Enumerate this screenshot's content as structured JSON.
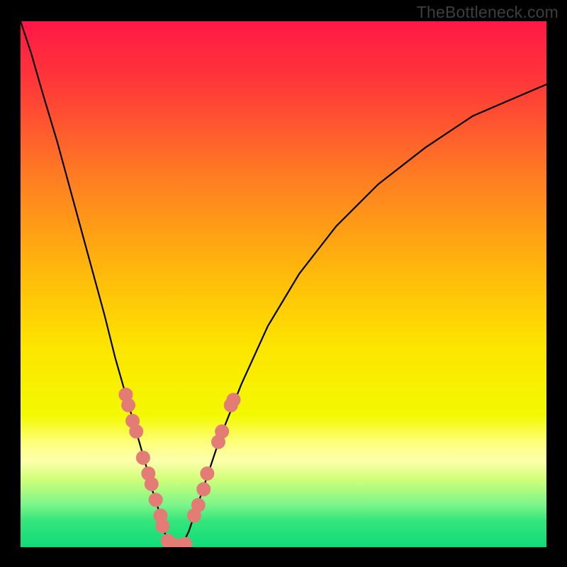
{
  "watermark": "TheBottleneck.com",
  "chart_data": {
    "type": "line",
    "title": "",
    "xlabel": "",
    "ylabel": "",
    "xlim": [
      0,
      100
    ],
    "ylim": [
      0,
      100
    ],
    "grid": false,
    "legend": "none",
    "background": {
      "type": "vertical-gradient",
      "stops": [
        {
          "pos": 0.0,
          "color": "#ff1846"
        },
        {
          "pos": 0.12,
          "color": "#ff3939"
        },
        {
          "pos": 0.3,
          "color": "#ff7e22"
        },
        {
          "pos": 0.48,
          "color": "#ffba0b"
        },
        {
          "pos": 0.62,
          "color": "#fde500"
        },
        {
          "pos": 0.75,
          "color": "#f3f901"
        },
        {
          "pos": 0.8,
          "color": "#feff7a"
        },
        {
          "pos": 0.835,
          "color": "#fdffad"
        },
        {
          "pos": 0.87,
          "color": "#d2ff7a"
        },
        {
          "pos": 0.92,
          "color": "#7af589"
        },
        {
          "pos": 0.95,
          "color": "#35e57c"
        },
        {
          "pos": 1.0,
          "color": "#0edc78"
        }
      ]
    },
    "curve": {
      "description": "V-shaped bottleneck curve, minimum near x≈28, value≈0; rises to ~100 at x=0 and ~88 at x=100.",
      "x": [
        0,
        2,
        4,
        7,
        10,
        13,
        16,
        18,
        20,
        22,
        24,
        25,
        26,
        27,
        28,
        29,
        30,
        31,
        32,
        33,
        35,
        38,
        42,
        47,
        53,
        60,
        68,
        77,
        86,
        93,
        100
      ],
      "y": [
        100,
        94,
        87,
        77,
        66,
        55,
        44,
        36,
        29,
        22,
        15,
        11,
        8,
        4,
        1,
        0,
        0,
        1,
        3,
        6,
        12,
        21,
        31,
        42,
        52,
        61,
        69,
        76,
        82,
        85,
        88
      ]
    },
    "markers": {
      "description": "Salmon-colored dot clusters on both flanks of the V and at the base.",
      "color": "#e47c76",
      "radius_px": 10,
      "points": [
        {
          "x": 20.0,
          "y": 29
        },
        {
          "x": 20.5,
          "y": 27
        },
        {
          "x": 21.3,
          "y": 24
        },
        {
          "x": 22.0,
          "y": 22
        },
        {
          "x": 23.3,
          "y": 17
        },
        {
          "x": 24.3,
          "y": 14
        },
        {
          "x": 24.9,
          "y": 12
        },
        {
          "x": 25.7,
          "y": 9
        },
        {
          "x": 26.6,
          "y": 6
        },
        {
          "x": 27.0,
          "y": 4
        },
        {
          "x": 28.0,
          "y": 1.2
        },
        {
          "x": 28.8,
          "y": 0.5
        },
        {
          "x": 29.7,
          "y": 0.3
        },
        {
          "x": 30.5,
          "y": 0.3
        },
        {
          "x": 31.3,
          "y": 0.6
        },
        {
          "x": 33.0,
          "y": 6
        },
        {
          "x": 33.8,
          "y": 8
        },
        {
          "x": 34.8,
          "y": 11
        },
        {
          "x": 35.5,
          "y": 14
        },
        {
          "x": 37.6,
          "y": 20
        },
        {
          "x": 38.3,
          "y": 22
        },
        {
          "x": 40.0,
          "y": 27
        },
        {
          "x": 40.5,
          "y": 28
        }
      ]
    }
  }
}
